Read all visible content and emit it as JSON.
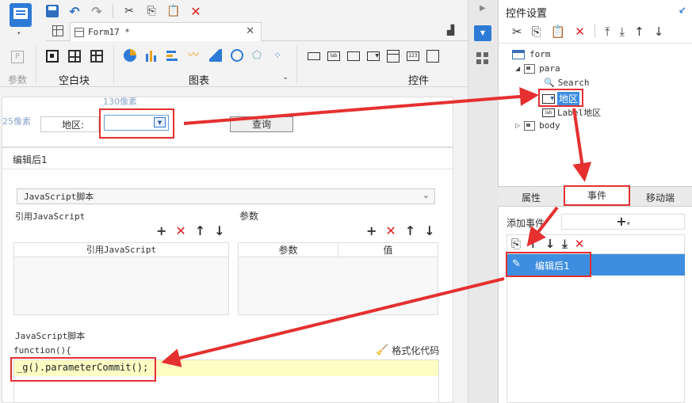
{
  "toolbar": {
    "tab_title": "Form17 *",
    "groups": {
      "params": "参数",
      "blank": "空白块",
      "chart": "图表",
      "widget": "控件"
    }
  },
  "canvas": {
    "width_hint": "130像素",
    "height_hint": "25像素",
    "region_label": "地区:",
    "query_label": "查询"
  },
  "editor": {
    "title": "编辑后1",
    "type_select": "JavaScript脚本",
    "ref_js_label": "引用JavaScript",
    "params_label": "参数",
    "ref_js_col": "引用JavaScript",
    "param_col": "参数",
    "value_col": "值",
    "script_label": "JavaScript脚本",
    "func_header": "function(){",
    "format_label": "格式化代码",
    "code": "_g().parameterCommit();"
  },
  "right": {
    "title": "控件设置",
    "tree": {
      "form": "form",
      "para": "para",
      "search": "Search",
      "region": "地区",
      "label_region": "Label地区",
      "body": "body"
    },
    "tabs": [
      "属性",
      "事件",
      "移动端"
    ],
    "add_event_label": "添加事件",
    "add_plus": "+",
    "event_item": "编辑后1"
  },
  "colors": {
    "accent": "#2e7bd6",
    "highlight": "#c8e0f8",
    "annotation_red": "#e53030",
    "code_bg": "#fdfdc4",
    "event_selected": "#3d8ee0"
  }
}
